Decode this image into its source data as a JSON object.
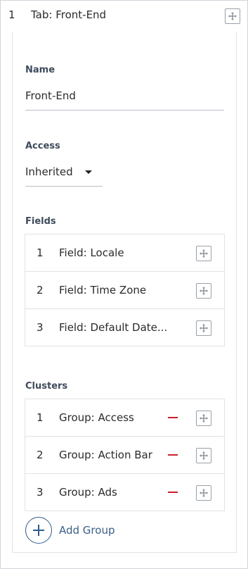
{
  "tab": {
    "number": "1",
    "title": "Tab: Front-End"
  },
  "name": {
    "label": "Name",
    "value": "Front-End"
  },
  "access": {
    "label": "Access",
    "value": "Inherited"
  },
  "fields": {
    "label": "Fields",
    "items": [
      {
        "num": "1",
        "label": "Field: Locale"
      },
      {
        "num": "2",
        "label": "Field: Time Zone"
      },
      {
        "num": "3",
        "label": "Field: Default Date..."
      }
    ]
  },
  "clusters": {
    "label": "Clusters",
    "items": [
      {
        "num": "1",
        "label": "Group: Access"
      },
      {
        "num": "2",
        "label": "Group: Action Bar"
      },
      {
        "num": "3",
        "label": "Group: Ads"
      }
    ],
    "add_label": "Add Group"
  },
  "colors": {
    "accent": "#2f5d8a",
    "remove": "#cc1f2a",
    "label": "#3f4b5c"
  },
  "icons": {
    "move": "move-icon",
    "caret": "caret-down-icon",
    "remove": "minus-icon",
    "add": "plus-circle-icon"
  }
}
